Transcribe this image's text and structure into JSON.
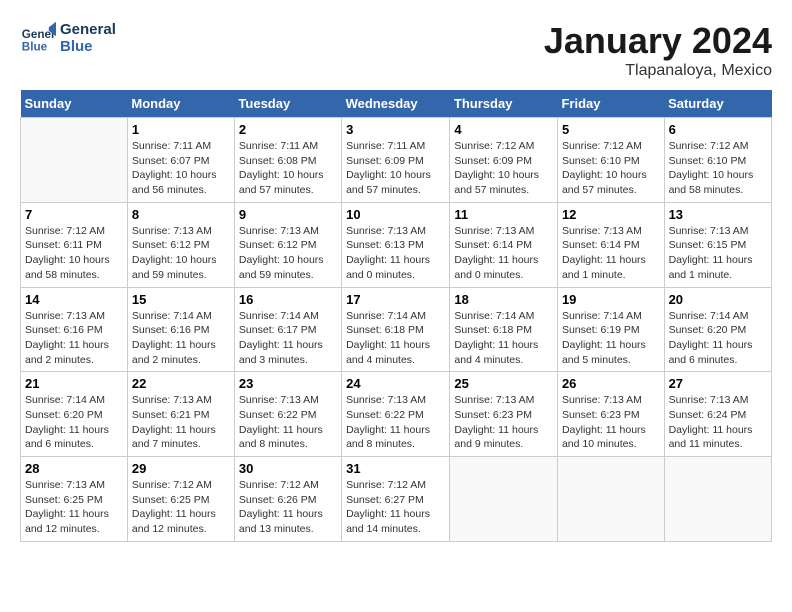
{
  "header": {
    "logo_line1": "General",
    "logo_line2": "Blue",
    "title": "January 2024",
    "subtitle": "Tlapanaloya, Mexico"
  },
  "weekdays": [
    "Sunday",
    "Monday",
    "Tuesday",
    "Wednesday",
    "Thursday",
    "Friday",
    "Saturday"
  ],
  "weeks": [
    [
      {
        "day": "",
        "info": ""
      },
      {
        "day": "1",
        "info": "Sunrise: 7:11 AM\nSunset: 6:07 PM\nDaylight: 10 hours\nand 56 minutes."
      },
      {
        "day": "2",
        "info": "Sunrise: 7:11 AM\nSunset: 6:08 PM\nDaylight: 10 hours\nand 57 minutes."
      },
      {
        "day": "3",
        "info": "Sunrise: 7:11 AM\nSunset: 6:09 PM\nDaylight: 10 hours\nand 57 minutes."
      },
      {
        "day": "4",
        "info": "Sunrise: 7:12 AM\nSunset: 6:09 PM\nDaylight: 10 hours\nand 57 minutes."
      },
      {
        "day": "5",
        "info": "Sunrise: 7:12 AM\nSunset: 6:10 PM\nDaylight: 10 hours\nand 57 minutes."
      },
      {
        "day": "6",
        "info": "Sunrise: 7:12 AM\nSunset: 6:10 PM\nDaylight: 10 hours\nand 58 minutes."
      }
    ],
    [
      {
        "day": "7",
        "info": "Sunrise: 7:12 AM\nSunset: 6:11 PM\nDaylight: 10 hours\nand 58 minutes."
      },
      {
        "day": "8",
        "info": "Sunrise: 7:13 AM\nSunset: 6:12 PM\nDaylight: 10 hours\nand 59 minutes."
      },
      {
        "day": "9",
        "info": "Sunrise: 7:13 AM\nSunset: 6:12 PM\nDaylight: 10 hours\nand 59 minutes."
      },
      {
        "day": "10",
        "info": "Sunrise: 7:13 AM\nSunset: 6:13 PM\nDaylight: 11 hours\nand 0 minutes."
      },
      {
        "day": "11",
        "info": "Sunrise: 7:13 AM\nSunset: 6:14 PM\nDaylight: 11 hours\nand 0 minutes."
      },
      {
        "day": "12",
        "info": "Sunrise: 7:13 AM\nSunset: 6:14 PM\nDaylight: 11 hours\nand 1 minute."
      },
      {
        "day": "13",
        "info": "Sunrise: 7:13 AM\nSunset: 6:15 PM\nDaylight: 11 hours\nand 1 minute."
      }
    ],
    [
      {
        "day": "14",
        "info": "Sunrise: 7:13 AM\nSunset: 6:16 PM\nDaylight: 11 hours\nand 2 minutes."
      },
      {
        "day": "15",
        "info": "Sunrise: 7:14 AM\nSunset: 6:16 PM\nDaylight: 11 hours\nand 2 minutes."
      },
      {
        "day": "16",
        "info": "Sunrise: 7:14 AM\nSunset: 6:17 PM\nDaylight: 11 hours\nand 3 minutes."
      },
      {
        "day": "17",
        "info": "Sunrise: 7:14 AM\nSunset: 6:18 PM\nDaylight: 11 hours\nand 4 minutes."
      },
      {
        "day": "18",
        "info": "Sunrise: 7:14 AM\nSunset: 6:18 PM\nDaylight: 11 hours\nand 4 minutes."
      },
      {
        "day": "19",
        "info": "Sunrise: 7:14 AM\nSunset: 6:19 PM\nDaylight: 11 hours\nand 5 minutes."
      },
      {
        "day": "20",
        "info": "Sunrise: 7:14 AM\nSunset: 6:20 PM\nDaylight: 11 hours\nand 6 minutes."
      }
    ],
    [
      {
        "day": "21",
        "info": "Sunrise: 7:14 AM\nSunset: 6:20 PM\nDaylight: 11 hours\nand 6 minutes."
      },
      {
        "day": "22",
        "info": "Sunrise: 7:13 AM\nSunset: 6:21 PM\nDaylight: 11 hours\nand 7 minutes."
      },
      {
        "day": "23",
        "info": "Sunrise: 7:13 AM\nSunset: 6:22 PM\nDaylight: 11 hours\nand 8 minutes."
      },
      {
        "day": "24",
        "info": "Sunrise: 7:13 AM\nSunset: 6:22 PM\nDaylight: 11 hours\nand 8 minutes."
      },
      {
        "day": "25",
        "info": "Sunrise: 7:13 AM\nSunset: 6:23 PM\nDaylight: 11 hours\nand 9 minutes."
      },
      {
        "day": "26",
        "info": "Sunrise: 7:13 AM\nSunset: 6:23 PM\nDaylight: 11 hours\nand 10 minutes."
      },
      {
        "day": "27",
        "info": "Sunrise: 7:13 AM\nSunset: 6:24 PM\nDaylight: 11 hours\nand 11 minutes."
      }
    ],
    [
      {
        "day": "28",
        "info": "Sunrise: 7:13 AM\nSunset: 6:25 PM\nDaylight: 11 hours\nand 12 minutes."
      },
      {
        "day": "29",
        "info": "Sunrise: 7:12 AM\nSunset: 6:25 PM\nDaylight: 11 hours\nand 12 minutes."
      },
      {
        "day": "30",
        "info": "Sunrise: 7:12 AM\nSunset: 6:26 PM\nDaylight: 11 hours\nand 13 minutes."
      },
      {
        "day": "31",
        "info": "Sunrise: 7:12 AM\nSunset: 6:27 PM\nDaylight: 11 hours\nand 14 minutes."
      },
      {
        "day": "",
        "info": ""
      },
      {
        "day": "",
        "info": ""
      },
      {
        "day": "",
        "info": ""
      }
    ]
  ]
}
